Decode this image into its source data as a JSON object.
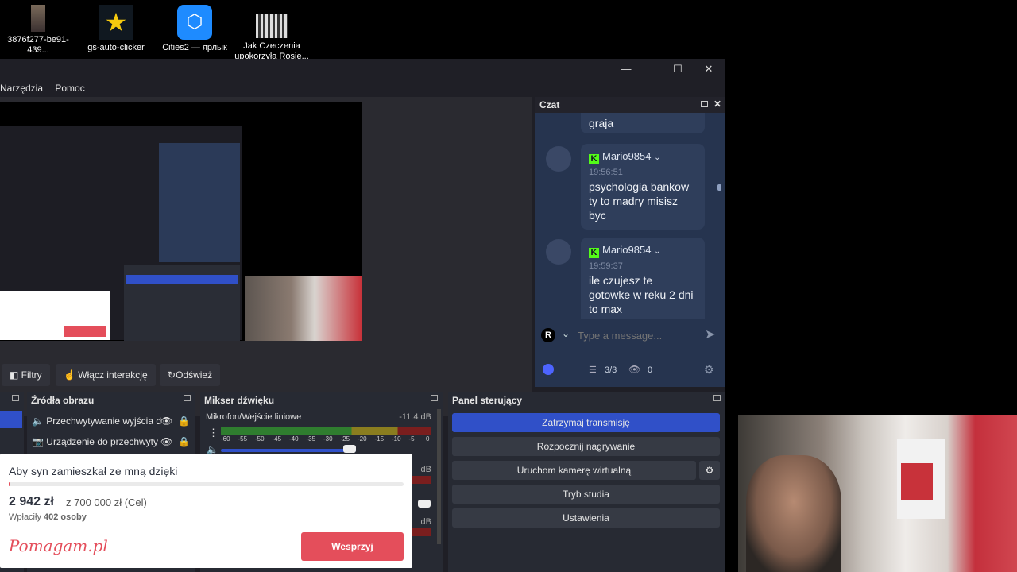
{
  "desktop": {
    "icons": [
      {
        "label": "3876f277-be91-439..."
      },
      {
        "label": "gs-auto-clicker"
      },
      {
        "label": "Cities2 — ярлык"
      },
      {
        "label": "Jak Czeczenia upokorzyła Rosię..."
      }
    ]
  },
  "obs": {
    "menu": [
      "Narzędzia",
      "Pomoc"
    ],
    "window_controls": {
      "minimize": "—",
      "maximize": "☐",
      "close": "✕"
    },
    "chat": {
      "title": "Czat",
      "partial_msg": "graja",
      "messages": [
        {
          "user": "Mario9854",
          "time": "19:56:51",
          "text": "psychologia bankow ty to madry misisz byc"
        },
        {
          "user": "Mario9854",
          "time": "19:59:37",
          "text": "ile czujesz te gotowke w reku 2 dni to max"
        }
      ],
      "input_placeholder": "Type a message...",
      "account_letter": "R",
      "viewers_slots": "3/3",
      "viewers_count": "0"
    },
    "toolbar": {
      "filters": "Filtry",
      "interact": "Włącz interakcję",
      "refresh": "Odśwież"
    },
    "sources": {
      "title": "Źródła obrazu",
      "items": [
        "Przechwytywanie wyjścia d",
        "Urządzenie do przechwyty"
      ]
    },
    "mixer": {
      "title": "Mikser dźwięku",
      "channel": "Mikrofon/Wejście liniowe",
      "level": "-11.4 dB",
      "scale": [
        "-60",
        "-55",
        "-50",
        "-45",
        "-40",
        "-35",
        "-30",
        "-25",
        "-20",
        "-15",
        "-10",
        "-5",
        "0"
      ],
      "other_level_1": "dB",
      "other_level_2": "dB"
    },
    "controls": {
      "title": "Panel sterujący",
      "stop_stream": "Zatrzymaj transmisję",
      "start_record": "Rozpocznij nagrywanie",
      "virtual_cam": "Uruchom kamerę wirtualną",
      "studio_mode": "Tryb studia",
      "settings": "Ustawienia"
    }
  },
  "donation": {
    "title": "Aby syn zamieszkał ze mną dzięki",
    "amount": "2 942 zł",
    "goal": "z 700 000 zł (Cel)",
    "payers_label": "Wpłaciły",
    "payers_count": "402 osoby",
    "logo": "Pomagam.pl",
    "button": "Wesprzyj",
    "progress": 0.0042
  },
  "colors": {
    "accent_blue": "#3050c8",
    "donate_red": "#e44e5b",
    "kick_green": "#53fc18"
  }
}
